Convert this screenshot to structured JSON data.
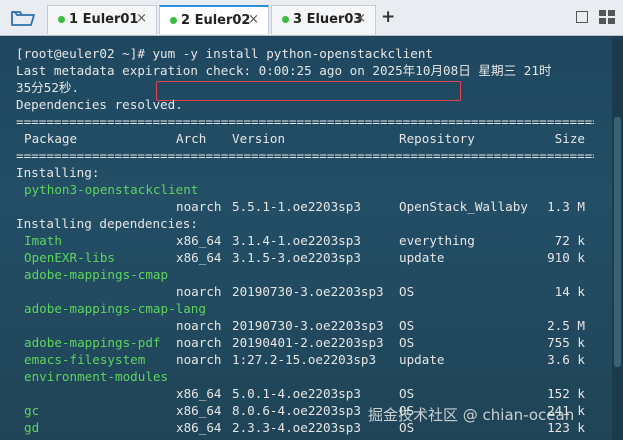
{
  "tabs": [
    {
      "label": "1 Euler01",
      "close": "×"
    },
    {
      "label": "2 Euler02",
      "close": "×"
    },
    {
      "label": "3 Eluer03",
      "close": "×"
    }
  ],
  "new_tab": "+",
  "terminal": {
    "prompt_line": "[root@euler02 ~]# yum -y install python-openstackclient",
    "metadata_line1": "Last metadata expiration check: 0:00:25 ago on 2025年10月08日 星期三 21时",
    "metadata_line2": "35分52秒.",
    "deps_resolved": "Dependencies resolved.",
    "separator": "================================================================================",
    "header": {
      "package": "Package",
      "arch": "Arch",
      "version": "Version",
      "repository": "Repository",
      "size": "Size"
    },
    "installing_label": "Installing:",
    "installing_deps_label": "Installing dependencies:",
    "packages": [
      {
        "name": "python3-openstackclient",
        "arch": "noarch",
        "version": "5.5.1-1.oe2203sp3",
        "repo": "OpenStack_Wallaby",
        "size": "1.3 M"
      },
      {
        "name": "Imath",
        "arch": "x86_64",
        "version": "3.1.4-1.oe2203sp3",
        "repo": "everything",
        "size": "72 k"
      },
      {
        "name": "OpenEXR-libs",
        "arch": "x86_64",
        "version": "3.1.5-3.oe2203sp3",
        "repo": "update",
        "size": "910 k"
      },
      {
        "name": "adobe-mappings-cmap",
        "arch": "noarch",
        "version": "20190730-3.oe2203sp3",
        "repo": "OS",
        "size": "14 k"
      },
      {
        "name": "adobe-mappings-cmap-lang",
        "arch": "noarch",
        "version": "20190730-3.oe2203sp3",
        "repo": "OS",
        "size": "2.5 M"
      },
      {
        "name": "adobe-mappings-pdf",
        "arch": "noarch",
        "version": "20190401-2.oe2203sp3",
        "repo": "OS",
        "size": "755 k"
      },
      {
        "name": "emacs-filesystem",
        "arch": "noarch",
        "version": "1:27.2-15.oe2203sp3",
        "repo": "update",
        "size": "3.6 k"
      },
      {
        "name": "environment-modules",
        "arch": "x86_64",
        "version": "5.0.1-4.oe2203sp3",
        "repo": "OS",
        "size": "152 k"
      },
      {
        "name": "gc",
        "arch": "x86_64",
        "version": "8.0.6-4.oe2203sp3",
        "repo": "OS",
        "size": "241 k"
      },
      {
        "name": "gd",
        "arch": "x86_64",
        "version": "2.3.3-4.oe2203sp3",
        "repo": "OS",
        "size": "123 k"
      }
    ]
  },
  "watermark": "掘金技术社区 @ chian-ocean"
}
